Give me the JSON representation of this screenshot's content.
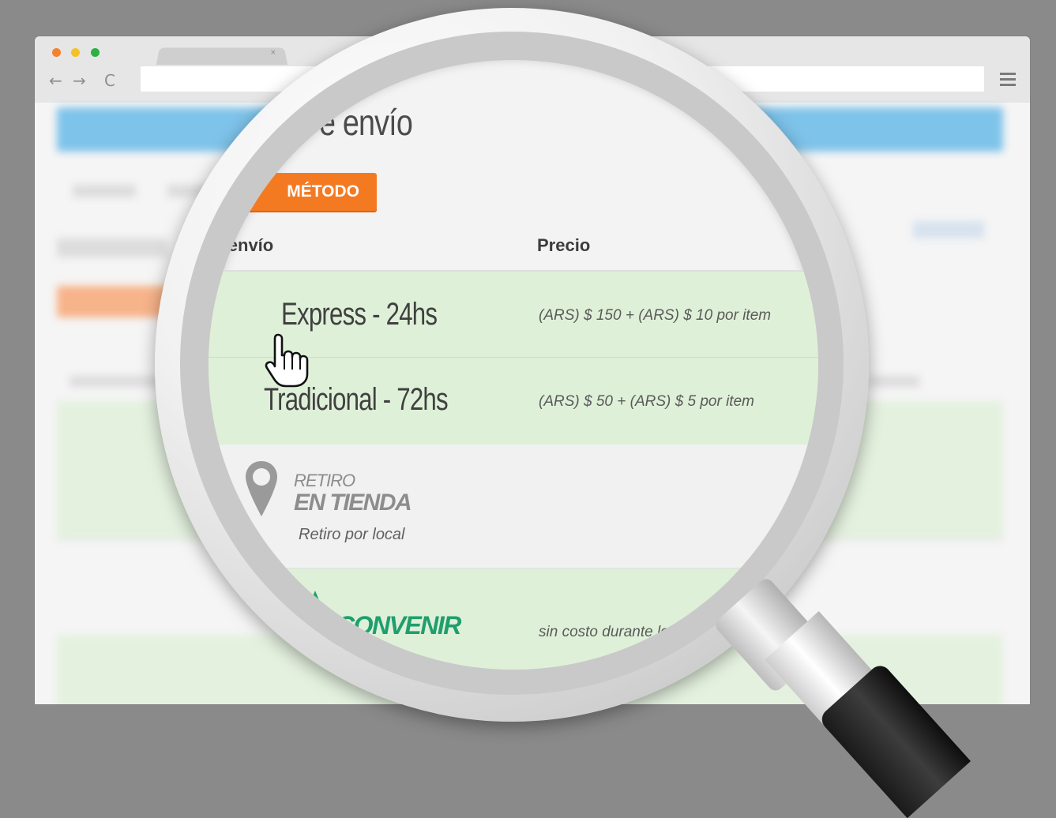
{
  "browser": {
    "tab_close": "×",
    "back": "←",
    "forward": "→",
    "reload": "C",
    "address_value": ""
  },
  "page": {
    "title": "e envío",
    "add_button": "MÉTODO",
    "table": {
      "headers": {
        "method": "do de envío",
        "price": "Precio"
      },
      "rows": [
        {
          "method": "Express - 24hs",
          "price": "(ARS) $ 150 + (ARS) $ 10 por item"
        },
        {
          "method": "Tradicional - 72hs",
          "price": "(ARS) $ 50 + (ARS) $ 5 por item"
        },
        {
          "logo_top": "RETIRO",
          "logo_bottom": "EN TIENDA",
          "method": "Retiro por local",
          "price": ""
        },
        {
          "logo": "CONVENIR",
          "price": "sin costo durante lo"
        }
      ]
    }
  },
  "colors": {
    "accent_orange": "#f47a22",
    "row_green": "#dff0d8",
    "header_blue": "#7ec3ea",
    "convenir_green": "#1f9e6e"
  }
}
